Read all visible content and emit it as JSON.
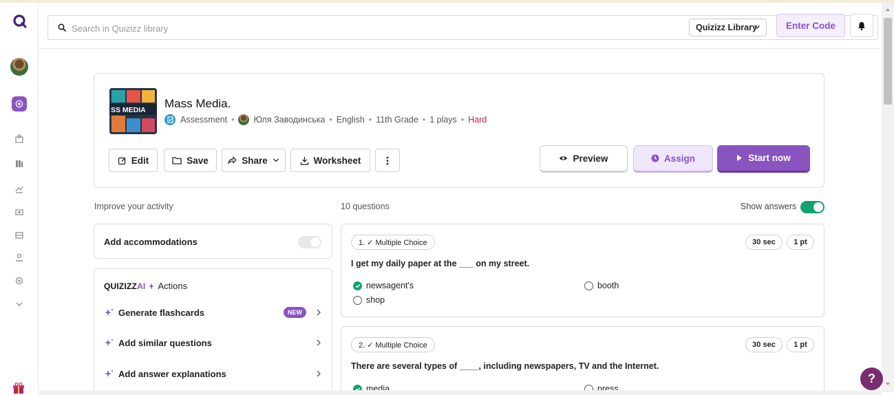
{
  "search": {
    "placeholder": "Search in Quizizz library",
    "library_select": "Quizizz Library",
    "enter_code": "Enter Code"
  },
  "quiz": {
    "title": "Mass Media.",
    "thumbnail_text": "SS MEDIA",
    "type": "Assessment",
    "author": "Юля Заводинська",
    "subject": "English",
    "grade": "11th Grade",
    "plays": "1 plays",
    "difficulty": "Hard",
    "actions": {
      "edit": "Edit",
      "save": "Save",
      "share": "Share",
      "worksheet": "Worksheet"
    },
    "preview": "Preview",
    "assign": "Assign",
    "start": "Start now"
  },
  "improve": {
    "heading": "Improve your activity",
    "accommodations": "Add accommodations",
    "ai_brand_a": "QUIZIZZ",
    "ai_brand_b": "AI",
    "ai_actions": "Actions",
    "items": [
      {
        "label": "Generate flashcards",
        "badge": "NEW"
      },
      {
        "label": "Add similar questions"
      },
      {
        "label": "Add answer explanations"
      }
    ]
  },
  "questions": {
    "count": "10 questions",
    "show_answers": "Show answers",
    "items": [
      {
        "type": "1. ✓ Multiple Choice",
        "time": "30 sec",
        "points": "1 pt",
        "text": "I get my daily paper at the ___ on my street.",
        "options": [
          {
            "text": "newsagent's",
            "correct": true
          },
          {
            "text": "booth",
            "correct": false
          },
          {
            "text": "shop",
            "correct": false
          }
        ]
      },
      {
        "type": "2. ✓ Multiple Choice",
        "time": "30 sec",
        "points": "1 pt",
        "text": "There are several types of ____, including newspapers, TV and the Internet.",
        "options": [
          {
            "text": "media",
            "correct": true
          },
          {
            "text": "press",
            "correct": false
          }
        ]
      }
    ]
  },
  "help": "?",
  "colors": {
    "brand_purple": "#8854c0",
    "correct_green": "#10a36e",
    "hard_red": "#c41e4a"
  }
}
